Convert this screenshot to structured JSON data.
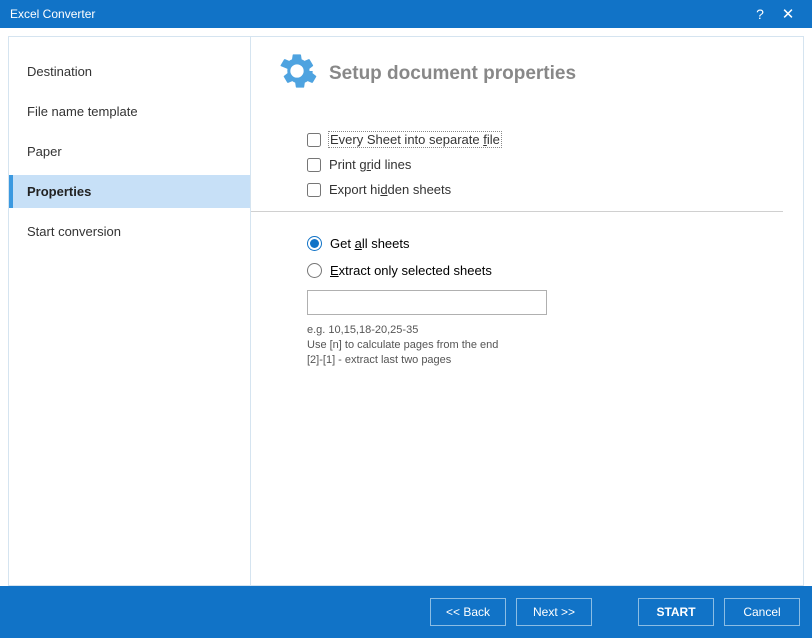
{
  "titlebar": {
    "title": "Excel Converter",
    "help": "?",
    "close": "✕"
  },
  "sidebar": {
    "items": [
      {
        "label": "Destination"
      },
      {
        "label": "File name template"
      },
      {
        "label": "Paper"
      },
      {
        "label": "Properties"
      },
      {
        "label": "Start conversion"
      }
    ],
    "activeIndex": 3
  },
  "main": {
    "pageTitle": "Setup document properties",
    "checkboxes": [
      {
        "prefix": "Every Sheet into separate ",
        "hotkey": "f",
        "suffix": "ile",
        "checked": false
      },
      {
        "prefix": "Print g",
        "hotkey": "r",
        "suffix": "id lines",
        "checked": false
      },
      {
        "prefix": "Export hi",
        "hotkey": "d",
        "suffix": "den sheets",
        "checked": false
      }
    ],
    "radios": [
      {
        "prefix": "Get ",
        "hotkey": "a",
        "suffix": "ll sheets",
        "checked": true
      },
      {
        "prefix": "",
        "hotkey": "E",
        "suffix": "xtract only selected sheets",
        "checked": false
      }
    ],
    "rangeValue": "",
    "hint1": "e.g. 10,15,18-20,25-35",
    "hint2": "Use [n] to calculate pages from the end",
    "hint3": "[2]-[1] - extract last two pages"
  },
  "footer": {
    "back": "<<  Back",
    "next": "Next  >>",
    "start": "START",
    "cancel": "Cancel"
  }
}
